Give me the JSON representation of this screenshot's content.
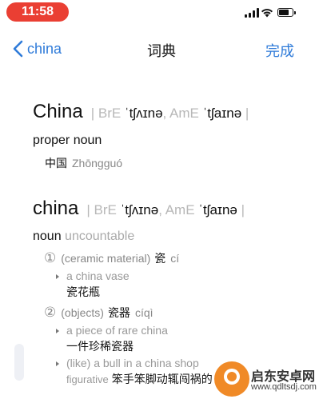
{
  "status_bar": {
    "time": "11:58"
  },
  "nav": {
    "back_label": "china",
    "title": "词典",
    "done_label": "完成",
    "accent_color": "#2f7bd9"
  },
  "entries": [
    {
      "headword": "China",
      "pron_open": "| BrE ",
      "bre_ipa": "ˈtʃʌɪnə",
      "pron_mid": ", AmE ",
      "ame_ipa": "ˈtʃaɪnə",
      "pron_close": " |",
      "pos": "proper noun",
      "translation_zh": "中国",
      "translation_pinyin": "Zhōngguó"
    },
    {
      "headword": "china",
      "pron_open": "| BrE ",
      "bre_ipa": "ˈtʃʌɪnə",
      "pron_mid": ", AmE ",
      "ame_ipa": "ˈtʃaɪnə",
      "pron_close": " |",
      "pos": "noun",
      "pos_sub": "uncountable",
      "senses": [
        {
          "number": "①",
          "gloss": "(ceramic material)",
          "zh": "瓷",
          "pinyin": "cí",
          "examples": [
            {
              "en": "a china vase",
              "zh": "瓷花瓶"
            }
          ]
        },
        {
          "number": "②",
          "gloss": "(objects)",
          "zh": "瓷器",
          "pinyin": "cíqì",
          "examples": [
            {
              "en": "a piece of rare china",
              "zh": "一件珍稀瓷器"
            },
            {
              "en": "(like) a bull in a china shop",
              "figurative": "figurative",
              "zh": "笨手笨脚动辄闯祸的"
            }
          ]
        }
      ]
    }
  ],
  "watermark": {
    "name": "启东安卓网",
    "url": "www.qdltsdj.com"
  }
}
